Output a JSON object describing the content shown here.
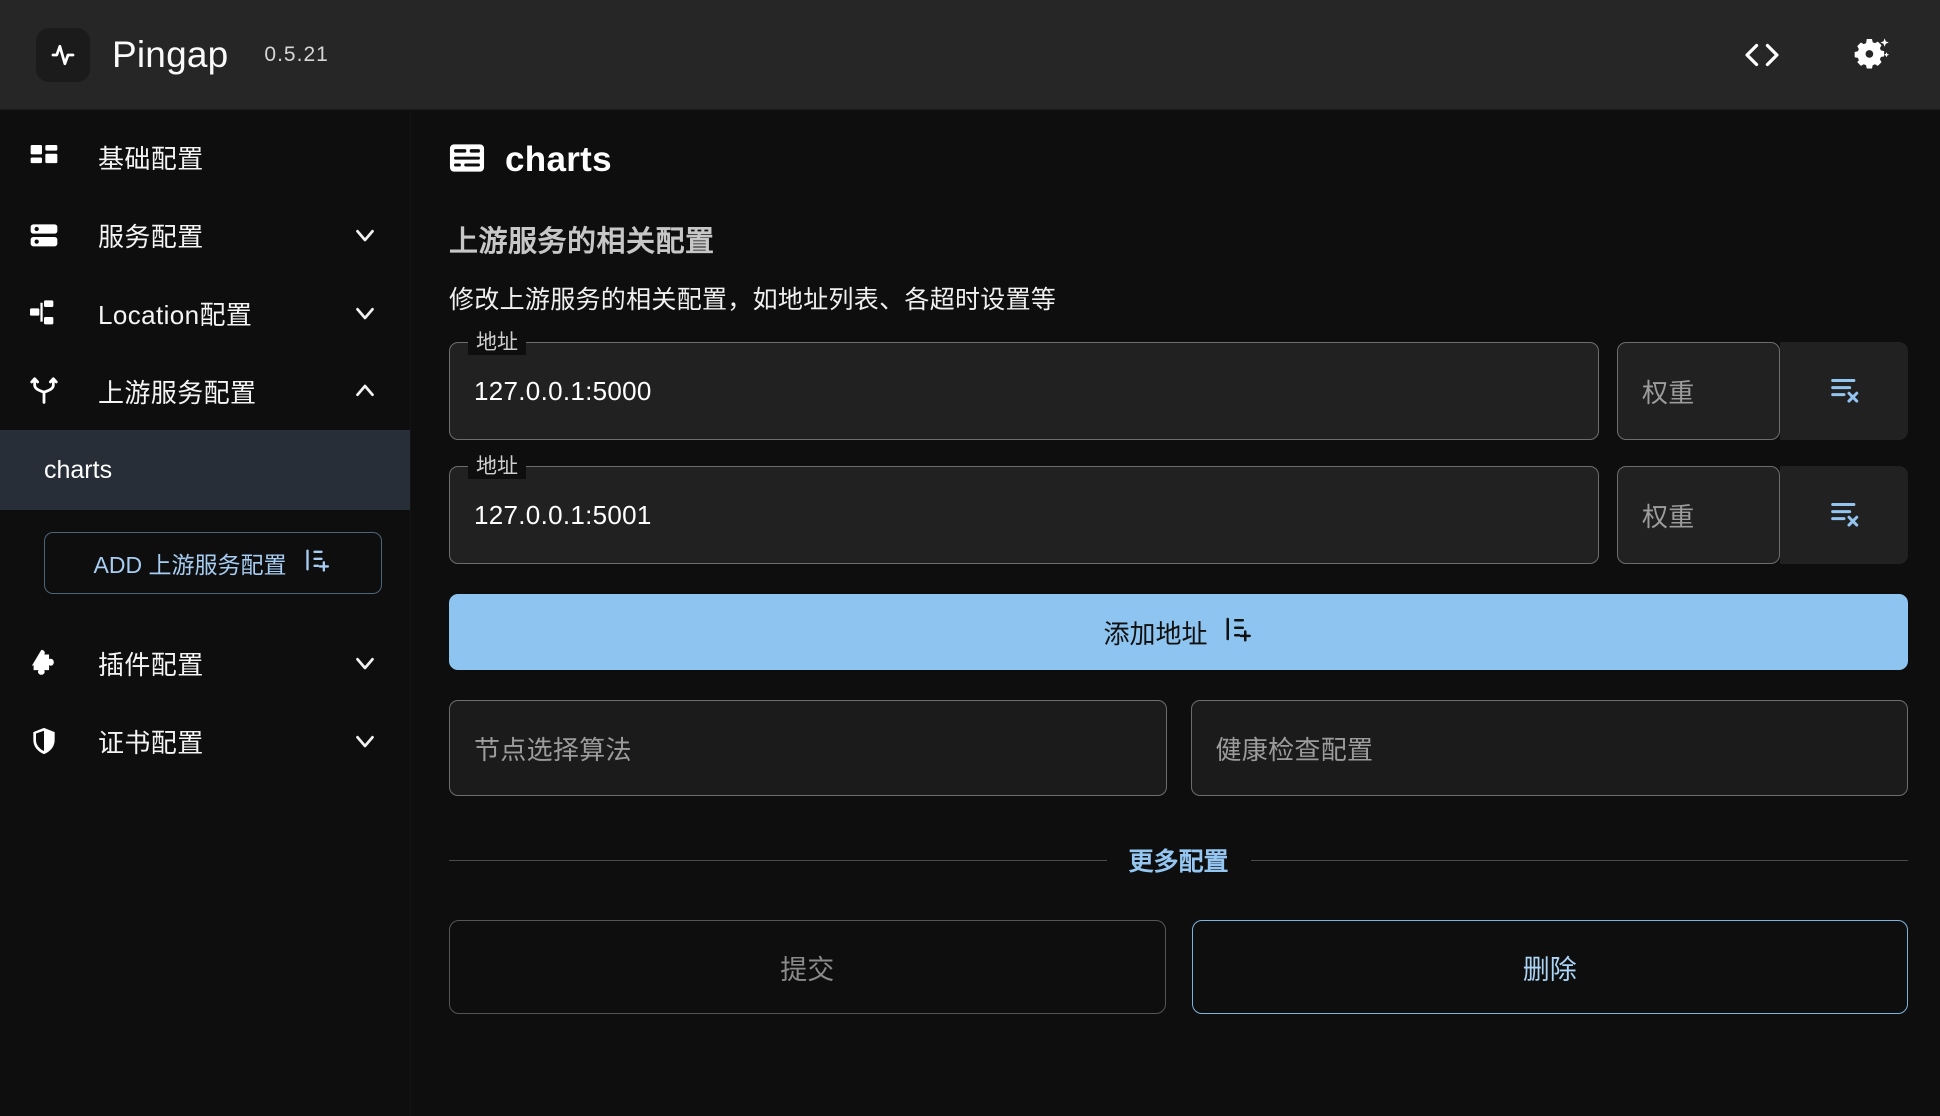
{
  "header": {
    "app_name": "Pingap",
    "version": "0.5.21",
    "logo_icon": "activity-pulse-icon",
    "actions": [
      {
        "name": "code-brackets-icon",
        "label": "<>"
      },
      {
        "name": "gear-sparkle-icon",
        "label": "settings"
      }
    ]
  },
  "sidebar": {
    "items": [
      {
        "label": "基础配置",
        "icon": "layout-dashboard-icon",
        "expandable": false,
        "expanded": false
      },
      {
        "label": "服务配置",
        "icon": "server-icon",
        "expandable": true,
        "expanded": false
      },
      {
        "label": "Location配置",
        "icon": "network-icon",
        "expandable": true,
        "expanded": false
      },
      {
        "label": "上游服务配置",
        "icon": "git-fork-icon",
        "expandable": true,
        "expanded": true
      },
      {
        "label": "插件配置",
        "icon": "puzzle-icon",
        "expandable": true,
        "expanded": false
      },
      {
        "label": "证书配置",
        "icon": "shield-icon",
        "expandable": true,
        "expanded": false
      }
    ],
    "active_subitem": "charts",
    "add_button": {
      "label": "ADD 上游服务配置",
      "icon": "list-plus-icon"
    }
  },
  "main": {
    "page_title": "charts",
    "page_title_icon": "panel-card-icon",
    "section_title": "上游服务的相关配置",
    "section_desc": "修改上游服务的相关配置，如地址列表、各超时设置等",
    "addresses": [
      {
        "label": "地址",
        "value": "127.0.0.1:5000",
        "weight_placeholder": "权重",
        "weight_value": "",
        "remove_icon": "list-x-icon"
      },
      {
        "label": "地址",
        "value": "127.0.0.1:5001",
        "weight_placeholder": "权重",
        "weight_value": "",
        "remove_icon": "list-x-icon"
      }
    ],
    "add_address_button": {
      "label": "添加地址",
      "icon": "list-plus-icon"
    },
    "fields": [
      {
        "placeholder": "节点选择算法",
        "value": ""
      },
      {
        "placeholder": "健康检查配置",
        "value": ""
      }
    ],
    "more_config_label": "更多配置",
    "submit_button": {
      "label": "提交",
      "disabled": true
    },
    "delete_button": {
      "label": "删除",
      "disabled": false
    }
  },
  "colors": {
    "accent_blue": "#8ec5f0",
    "link_blue": "#94c6f1",
    "sidebar_active_bg": "#272e38",
    "topbar_bg": "#262626",
    "page_bg": "#0e0e0e"
  }
}
